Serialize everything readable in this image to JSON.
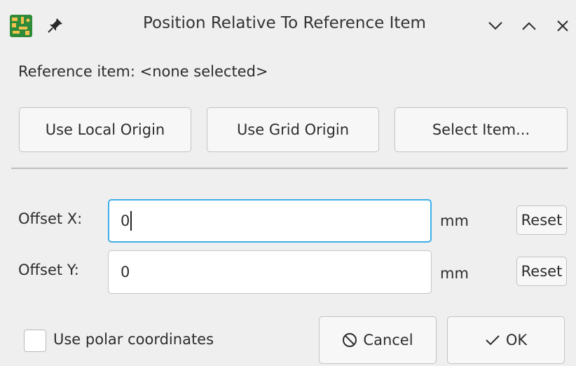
{
  "window": {
    "title": "Position Relative To Reference Item",
    "app_icon": "kicad-pcb-icon",
    "pin_icon": "pin-icon",
    "controls": [
      "minimize-icon",
      "maximize-icon",
      "close-icon"
    ]
  },
  "reference": {
    "label": "Reference item: <none selected>"
  },
  "origin_buttons": {
    "local": "Use Local Origin",
    "grid": "Use Grid Origin",
    "select": "Select Item..."
  },
  "offset_x": {
    "label": "Offset X:",
    "value": "0",
    "unit": "mm",
    "reset": "Reset"
  },
  "offset_y": {
    "label": "Offset Y:",
    "value": "0",
    "unit": "mm",
    "reset": "Reset"
  },
  "polar": {
    "label": "Use polar coordinates",
    "checked": false
  },
  "actions": {
    "cancel": "Cancel",
    "ok": "OK"
  },
  "colors": {
    "background": "#efefef",
    "focus_border": "#3daee9",
    "app_icon_green": "#2f8a3a"
  }
}
